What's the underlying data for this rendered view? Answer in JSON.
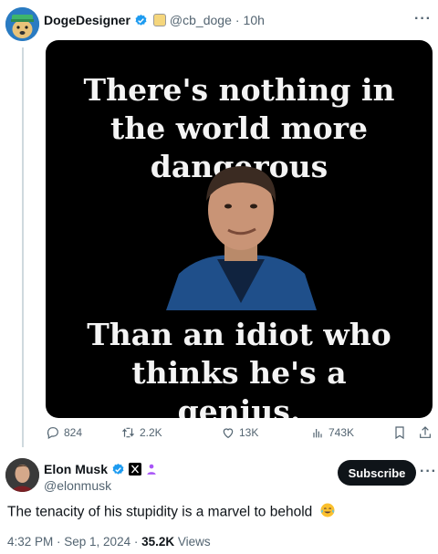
{
  "original_post": {
    "display_name": "DogeDesigner",
    "handle": "@cb_doge",
    "separator": "·",
    "time": "10h",
    "more": "···",
    "image_text_top": "There's nothing in the world more dangerous",
    "image_text_bottom": "Than an idiot who thinks he's a genius.",
    "stats": {
      "replies": "824",
      "reposts": "2.2K",
      "likes": "13K",
      "views": "743K"
    },
    "icons": [
      "reply-icon",
      "repost-icon",
      "like-icon",
      "views-icon",
      "bookmark-icon",
      "share-icon"
    ]
  },
  "reply": {
    "display_name": "Elon Musk",
    "handle": "@elonmusk",
    "subscribe_label": "Subscribe",
    "more": "···",
    "text": "The tenacity of his stupidity is a marvel to behold",
    "timestamp": "4:32 PM · Sep 1, 2024 · ",
    "views_count": "35.2K",
    "views_label": " Views"
  },
  "colors": {
    "verified_blue": "#1d9bf0",
    "text_primary": "#0f1419",
    "text_secondary": "#536471",
    "image_background": "#000000"
  }
}
